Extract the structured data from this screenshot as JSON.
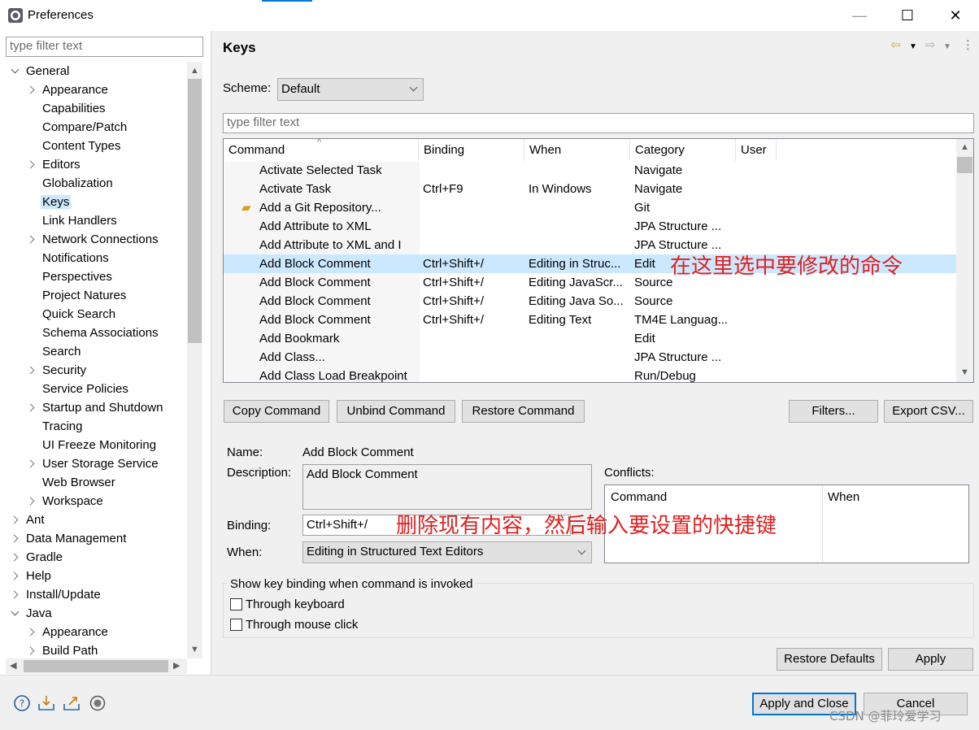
{
  "window": {
    "title": "Preferences",
    "min": "—",
    "max": "☐",
    "close": "✕"
  },
  "left": {
    "filter_placeholder": "type filter text",
    "tree": [
      {
        "label": "General",
        "level": 0,
        "state": "expanded"
      },
      {
        "label": "Appearance",
        "level": 1,
        "state": "collapsed"
      },
      {
        "label": "Capabilities",
        "level": 1,
        "state": "leaf"
      },
      {
        "label": "Compare/Patch",
        "level": 1,
        "state": "leaf"
      },
      {
        "label": "Content Types",
        "level": 1,
        "state": "leaf"
      },
      {
        "label": "Editors",
        "level": 1,
        "state": "collapsed"
      },
      {
        "label": "Globalization",
        "level": 1,
        "state": "leaf"
      },
      {
        "label": "Keys",
        "level": 1,
        "state": "leaf",
        "selected": true
      },
      {
        "label": "Link Handlers",
        "level": 1,
        "state": "leaf"
      },
      {
        "label": "Network Connections",
        "level": 1,
        "state": "collapsed"
      },
      {
        "label": "Notifications",
        "level": 1,
        "state": "leaf"
      },
      {
        "label": "Perspectives",
        "level": 1,
        "state": "leaf"
      },
      {
        "label": "Project Natures",
        "level": 1,
        "state": "leaf"
      },
      {
        "label": "Quick Search",
        "level": 1,
        "state": "leaf"
      },
      {
        "label": "Schema Associations",
        "level": 1,
        "state": "leaf"
      },
      {
        "label": "Search",
        "level": 1,
        "state": "leaf"
      },
      {
        "label": "Security",
        "level": 1,
        "state": "collapsed"
      },
      {
        "label": "Service Policies",
        "level": 1,
        "state": "leaf"
      },
      {
        "label": "Startup and Shutdown",
        "level": 1,
        "state": "collapsed"
      },
      {
        "label": "Tracing",
        "level": 1,
        "state": "leaf"
      },
      {
        "label": "UI Freeze Monitoring",
        "level": 1,
        "state": "leaf"
      },
      {
        "label": "User Storage Service",
        "level": 1,
        "state": "collapsed"
      },
      {
        "label": "Web Browser",
        "level": 1,
        "state": "leaf"
      },
      {
        "label": "Workspace",
        "level": 1,
        "state": "collapsed"
      },
      {
        "label": "Ant",
        "level": 0,
        "state": "collapsed"
      },
      {
        "label": "Data Management",
        "level": 0,
        "state": "collapsed"
      },
      {
        "label": "Gradle",
        "level": 0,
        "state": "collapsed"
      },
      {
        "label": "Help",
        "level": 0,
        "state": "collapsed"
      },
      {
        "label": "Install/Update",
        "level": 0,
        "state": "collapsed"
      },
      {
        "label": "Java",
        "level": 0,
        "state": "expanded"
      },
      {
        "label": "Appearance",
        "level": 1,
        "state": "collapsed"
      },
      {
        "label": "Build Path",
        "level": 1,
        "state": "collapsed"
      }
    ]
  },
  "right": {
    "title": "Keys",
    "scheme_label": "Scheme:",
    "scheme_value": "Default",
    "filter_placeholder": "type filter text",
    "columns": [
      "Command",
      "Binding",
      "When",
      "Category",
      "User"
    ],
    "rows": [
      {
        "command": "Activate Selected Task",
        "binding": "",
        "when": "",
        "category": "Navigate",
        "user": ""
      },
      {
        "command": "Activate Task",
        "binding": "Ctrl+F9",
        "when": "In Windows",
        "category": "Navigate",
        "user": ""
      },
      {
        "command": "Add a Git Repository...",
        "binding": "",
        "when": "",
        "category": "Git",
        "user": "",
        "icon": "git-repository-icon"
      },
      {
        "command": "Add Attribute to XML",
        "binding": "",
        "when": "",
        "category": "JPA Structure ...",
        "user": ""
      },
      {
        "command": "Add Attribute to XML and I",
        "binding": "",
        "when": "",
        "category": "JPA Structure ...",
        "user": ""
      },
      {
        "command": "Add Block Comment",
        "binding": "Ctrl+Shift+/",
        "when": "Editing in Struc...",
        "category": "Edit",
        "user": "",
        "selected": true
      },
      {
        "command": "Add Block Comment",
        "binding": "Ctrl+Shift+/",
        "when": "Editing JavaScr...",
        "category": "Source",
        "user": ""
      },
      {
        "command": "Add Block Comment",
        "binding": "Ctrl+Shift+/",
        "when": "Editing Java So...",
        "category": "Source",
        "user": ""
      },
      {
        "command": "Add Block Comment",
        "binding": "Ctrl+Shift+/",
        "when": "Editing Text",
        "category": "TM4E Languag...",
        "user": ""
      },
      {
        "command": "Add Bookmark",
        "binding": "",
        "when": "",
        "category": "Edit",
        "user": ""
      },
      {
        "command": "Add Class...",
        "binding": "",
        "when": "",
        "category": "JPA Structure ...",
        "user": ""
      },
      {
        "command": "Add Class Load Breakpoint",
        "binding": "",
        "when": "",
        "category": "Run/Debug",
        "user": ""
      }
    ],
    "buttons": {
      "copy": "Copy Command",
      "unbind": "Unbind Command",
      "restore": "Restore Command",
      "filters": "Filters...",
      "export": "Export CSV..."
    },
    "details": {
      "name_label": "Name:",
      "name_value": "Add Block Comment",
      "description_label": "Description:",
      "description_value": "Add Block Comment",
      "binding_label": "Binding:",
      "binding_value": "Ctrl+Shift+/",
      "when_label": "When:",
      "when_value": "Editing in Structured Text Editors",
      "conflicts_label": "Conflicts:",
      "conflicts_columns": [
        "Command",
        "When"
      ]
    },
    "show_binding": {
      "title": "Show key binding when command is invoked",
      "through_keyboard": "Through keyboard",
      "through_mouse": "Through mouse click"
    },
    "restore_defaults": "Restore Defaults",
    "apply": "Apply"
  },
  "footer": {
    "apply_close": "Apply and Close",
    "cancel": "Cancel",
    "icons": [
      "help-icon",
      "import-icon",
      "export-icon",
      "oomph-icon"
    ]
  },
  "annotations": {
    "select_command": "在这里选中要修改的命令",
    "binding_hint": "删除现有内容，然后输入要设置的快捷键"
  },
  "watermark": "CSDN @菲玲爱学习",
  "colors": {
    "selection": "#cce8ff",
    "accent": "#0078d7",
    "annotation": "#e02020"
  }
}
